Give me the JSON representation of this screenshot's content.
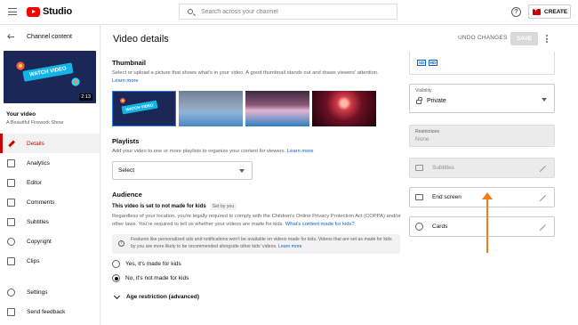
{
  "topbar": {
    "logo_text": "Studio",
    "search_placeholder": "Search across your channel",
    "help_glyph": "?",
    "create_label": "CREATE"
  },
  "sidebar": {
    "back_label": "Channel content",
    "thumbnail_banner": "WATCH VIDEO",
    "duration": "2:13",
    "your_video_label": "Your video",
    "video_title": "A Beautiful Firework Show",
    "items": [
      {
        "label": "Details",
        "icon": "pencil-icon",
        "active": true
      },
      {
        "label": "Analytics",
        "icon": "analytics-icon",
        "active": false
      },
      {
        "label": "Editor",
        "icon": "editor-icon",
        "active": false
      },
      {
        "label": "Comments",
        "icon": "comments-icon",
        "active": false
      },
      {
        "label": "Subtitles",
        "icon": "subtitles-icon",
        "active": false
      },
      {
        "label": "Copyright",
        "icon": "copyright-icon",
        "active": false
      },
      {
        "label": "Clips",
        "icon": "clips-icon",
        "active": false
      }
    ],
    "bottom_items": [
      {
        "label": "Settings",
        "icon": "gear-icon"
      },
      {
        "label": "Send feedback",
        "icon": "feedback-icon"
      }
    ]
  },
  "header": {
    "title": "Video details",
    "undo_label": "UNDO CHANGES",
    "save_label": "SAVE"
  },
  "thumbnail": {
    "title": "Thumbnail",
    "description": "Select or upload a picture that shows what's in your video. A good thumbnail stands out and draws viewers' attention.",
    "learn_more": "Learn more",
    "selected_banner": "WATCH VIDEO"
  },
  "playlists": {
    "title": "Playlists",
    "description": "Add your video to one or more playlists to organize your content for viewers.",
    "learn_more": "Learn more",
    "select_value": "Select"
  },
  "audience": {
    "title": "Audience",
    "status": "This video is set to not made for kids",
    "set_by": "Set by you",
    "description": "Regardless of your location, you're legally required to comply with the Children's Online Privacy Protection Act (COPPA) and/or other laws. You're required to tell us whether your videos are made for kids.",
    "description_link": "What's content made for kids?",
    "info_text": "Features like personalized ads and notifications won't be available on videos made for kids. Videos that are set as made for kids by you are more likely to be recommended alongside other kids' videos.",
    "info_link": "Learn more",
    "options": [
      {
        "label": "Yes, it's made for kids",
        "selected": false
      },
      {
        "label": "No, it's not made for kids",
        "selected": true
      }
    ],
    "age_restriction": "Age restriction (advanced)"
  },
  "right_panel": {
    "quality_badges": [
      "SD",
      "HD"
    ],
    "visibility_label": "Visibility",
    "visibility_value": "Private",
    "restrictions_label": "Restrictions",
    "restrictions_value": "None",
    "subtitles_label": "Subtitles",
    "end_screen_label": "End screen",
    "cards_label": "Cards"
  },
  "colors": {
    "accent": "#cc0000",
    "link": "#065fd4",
    "annotation_arrow": "#f07d17"
  }
}
